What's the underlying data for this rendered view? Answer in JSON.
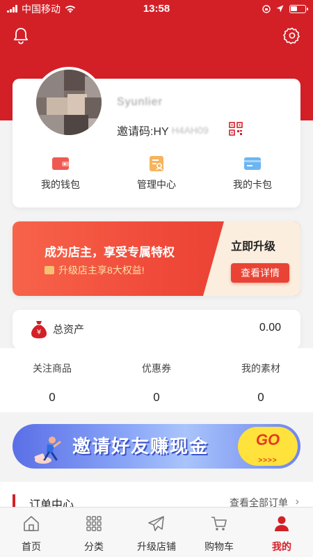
{
  "status_bar": {
    "carrier": "中国移动",
    "time": "13:58"
  },
  "profile": {
    "username": "Syunlier",
    "invite_label": "邀请码:HY",
    "invite_code": "H4AH09"
  },
  "quick_links": [
    {
      "label": "我的钱包",
      "icon": "wallet-icon"
    },
    {
      "label": "管理中心",
      "icon": "management-icon"
    },
    {
      "label": "我的卡包",
      "icon": "card-wallet-icon"
    }
  ],
  "promo": {
    "title": "成为店主，享受专属特权",
    "subtitle": "升级店主享8大权益!",
    "upgrade_label": "立即升级",
    "detail_button": "查看详情"
  },
  "assets": {
    "label": "总资产",
    "value": "0.00"
  },
  "stats": [
    {
      "label": "关注商品",
      "value": "0"
    },
    {
      "label": "优惠券",
      "value": "0"
    },
    {
      "label": "我的素材",
      "value": "0"
    }
  ],
  "invite_banner": {
    "text": "邀请好友赚现金",
    "go": "GO",
    "arrows": ">>>>"
  },
  "order_center": {
    "title": "订单中心",
    "view_all": "查看全部订单"
  },
  "tabbar": [
    {
      "label": "首页",
      "icon": "home-icon",
      "active": false
    },
    {
      "label": "分类",
      "icon": "category-icon",
      "active": false
    },
    {
      "label": "升级店铺",
      "icon": "paper-plane-icon",
      "active": false
    },
    {
      "label": "购物车",
      "icon": "cart-icon",
      "active": false
    },
    {
      "label": "我的",
      "icon": "user-icon",
      "active": true
    }
  ],
  "colors": {
    "brand_red": "#d32027",
    "promo_gradient_start": "#f7644a",
    "promo_gradient_end": "#e43a2e",
    "banner_yellow": "#ffe23b"
  }
}
